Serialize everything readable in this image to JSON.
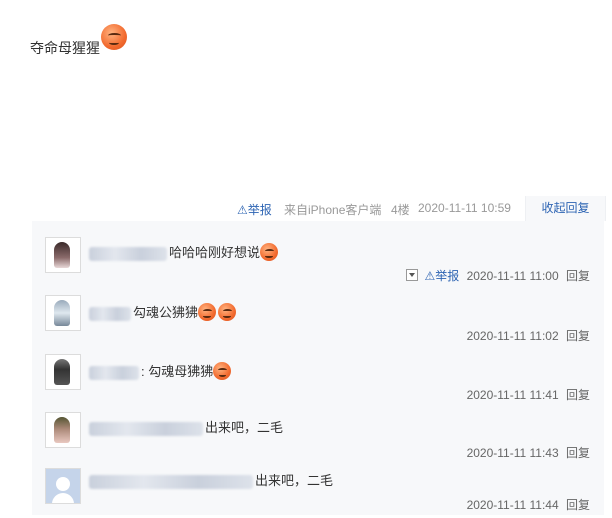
{
  "post": {
    "text": "夺命母猩猩",
    "emoji": "smiley-face-icon"
  },
  "meta": {
    "report_label": "举报",
    "source": "来自iPhone客户端",
    "floor": "4楼",
    "time": "2020-11-11 10:59",
    "collapse_label": "收起回复"
  },
  "replies": [
    {
      "text": "哈哈哈刚好想说",
      "emojis": 1,
      "has_report": true,
      "report_label": "举报",
      "time": "2020-11-11 11:00",
      "reply_label": "回复"
    },
    {
      "text": "勾魂公狒狒",
      "emojis": 2,
      "has_report": false,
      "time": "2020-11-11 11:02",
      "reply_label": "回复"
    },
    {
      "text": ": 勾魂母狒狒",
      "emojis": 1,
      "has_report": false,
      "time": "2020-11-11 11:41",
      "reply_label": "回复"
    },
    {
      "text": "出来吧，二毛",
      "emojis": 0,
      "has_report": false,
      "time": "2020-11-11 11:43",
      "reply_label": "回复"
    },
    {
      "text": "出来吧，二毛",
      "emojis": 0,
      "has_report": false,
      "time": "2020-11-11 11:44",
      "reply_label": "回复"
    }
  ],
  "colors": {
    "link": "#2d64b3",
    "reply_bg": "#f7f8fa"
  }
}
